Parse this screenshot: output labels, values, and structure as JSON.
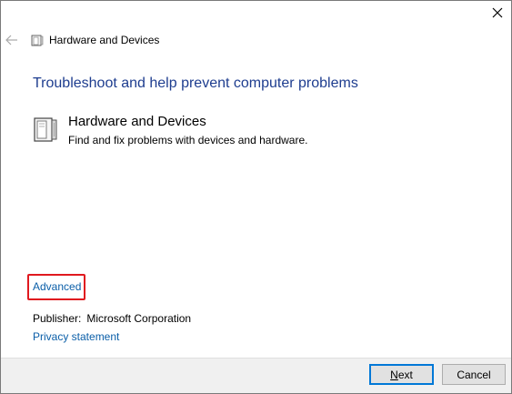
{
  "window": {
    "title": "Hardware and Devices",
    "close_glyph": "✕",
    "back_glyph": "←"
  },
  "main": {
    "heading": "Troubleshoot and help prevent computer problems",
    "item": {
      "icon": "hardware-devices-icon",
      "title": "Hardware and Devices",
      "description": "Find and fix problems with devices and hardware."
    },
    "advanced_link": "Advanced",
    "publisher_label": "Publisher:",
    "publisher_value": "Microsoft Corporation",
    "privacy_link": "Privacy statement"
  },
  "footer": {
    "next_mnemonic": "N",
    "next_rest": "ext",
    "cancel_label": "Cancel"
  },
  "colors": {
    "heading": "#1e3d8f",
    "link": "#0a5ea8",
    "highlight_border": "#e0191f",
    "footer_bg": "#f0f0f0",
    "default_button_border": "#0078d7"
  }
}
